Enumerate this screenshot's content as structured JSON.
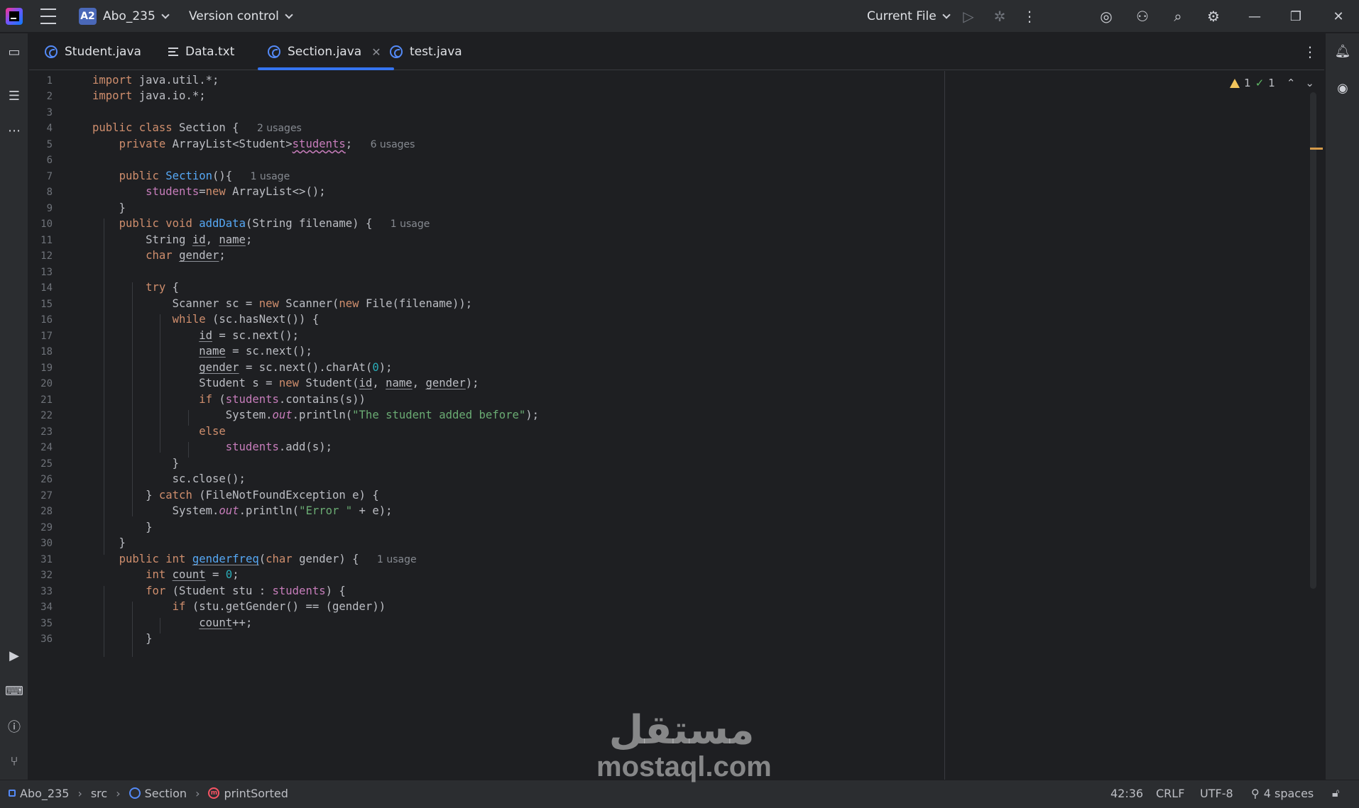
{
  "titlebar": {
    "project_badge": "A2",
    "project_name": "Abo_235",
    "vcs": "Version control",
    "run_config": "Current File"
  },
  "tabs": [
    {
      "label": "Student.java",
      "icon": "class-icon"
    },
    {
      "label": "Data.txt",
      "icon": "text-file-icon"
    },
    {
      "label": "Section.java",
      "icon": "class-icon",
      "active": true
    },
    {
      "label": "test.java",
      "icon": "class-icon"
    }
  ],
  "inspections": {
    "warnings": "1",
    "ok": "1"
  },
  "line_numbers": [
    "1",
    "2",
    "3",
    "4",
    "5",
    "6",
    "7",
    "8",
    "9",
    "10",
    "11",
    "12",
    "13",
    "14",
    "15",
    "16",
    "17",
    "18",
    "19",
    "20",
    "21",
    "22",
    "23",
    "24",
    "25",
    "26",
    "27",
    "28",
    "29",
    "30",
    "31",
    "32",
    "33",
    "34",
    "35",
    "36"
  ],
  "hints": {
    "class_usages": "2 usages",
    "field_usages": "6 usages",
    "ctor_usages": "1 usage",
    "adddata_usages": "1 usage",
    "genderfreq_usages": "1 usage"
  },
  "strings": {
    "added_before": "\"The student added before\"",
    "error": "\"Error \""
  },
  "statusbar": {
    "crumbs": [
      "Abo_235",
      "src",
      "Section",
      "printSorted"
    ],
    "position": "42:36",
    "line_sep": "CRLF",
    "encoding": "UTF-8",
    "indent": "4 spaces"
  },
  "watermark": {
    "arabic": "مستقل",
    "latin": "mostaql.com"
  },
  "colors": {
    "accent": "#3574f0",
    "keyword": "#cf8e6d",
    "function": "#56a8f5",
    "field": "#c77dbb",
    "string": "#6aab73",
    "number": "#2aacb8"
  }
}
